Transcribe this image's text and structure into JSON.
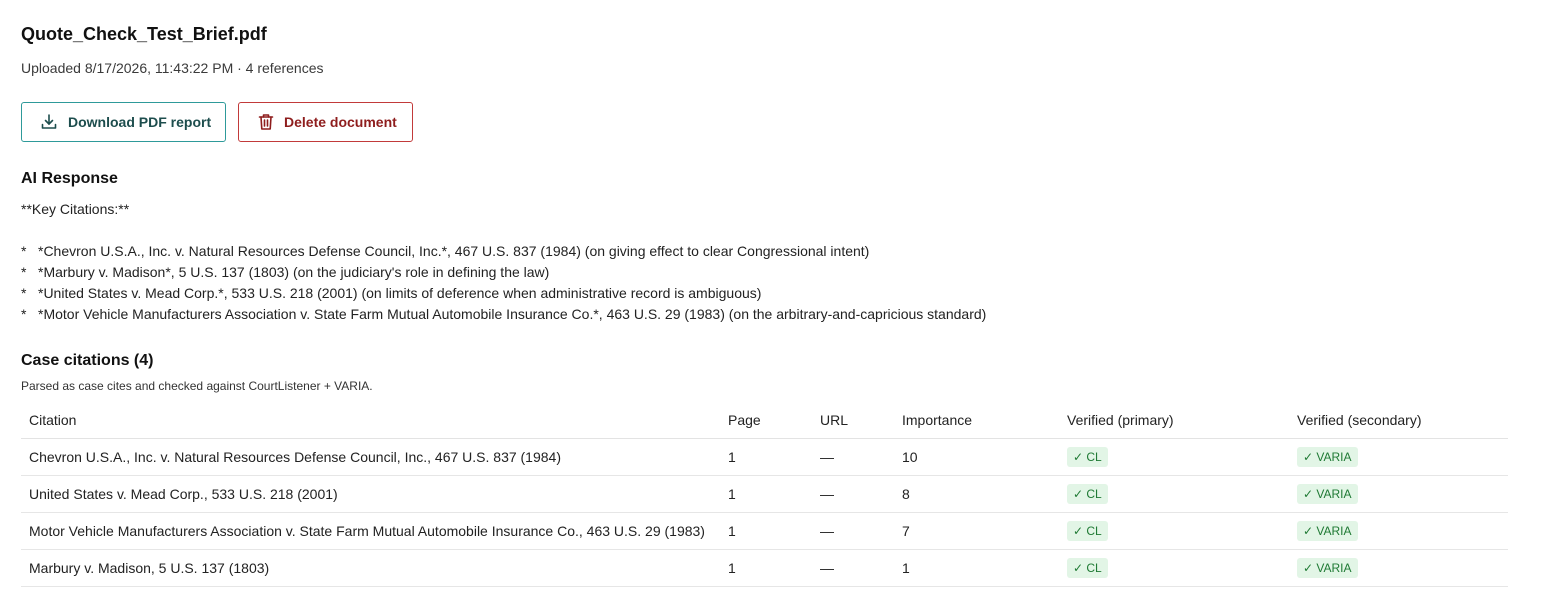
{
  "document": {
    "title": "Quote_Check_Test_Brief.pdf",
    "meta": "Uploaded 8/17/2026, 11:43:22 PM · 4 references"
  },
  "actions": {
    "download_label": "Download PDF report",
    "delete_label": "Delete document"
  },
  "ai_response": {
    "heading": "AI Response",
    "key_line": "**Key Citations:**",
    "bullet_char": "*",
    "items": [
      "*Chevron U.S.A., Inc. v. Natural Resources Defense Council, Inc.*, 467 U.S. 837 (1984) (on giving effect to clear Congressional intent)",
      "*Marbury v. Madison*, 5 U.S. 137 (1803) (on the judiciary's role in defining the law)",
      "*United States v. Mead Corp.*, 533 U.S. 218 (2001) (on limits of deference when administrative record is ambiguous)",
      "*Motor Vehicle Manufacturers Association v. State Farm Mutual Automobile Insurance Co.*, 463 U.S. 29 (1983) (on the arbitrary-and-capricious standard)"
    ]
  },
  "cases": {
    "heading": "Case citations (4)",
    "subtitle": "Parsed as case cites and checked against CourtListener + VARIA.",
    "columns": [
      "Citation",
      "Page",
      "URL",
      "Importance",
      "Verified (primary)",
      "Verified (secondary)"
    ],
    "rows": [
      {
        "citation": "Chevron U.S.A., Inc. v. Natural Resources Defense Council, Inc., 467 U.S. 837 (1984)",
        "page": "1",
        "url": "—",
        "importance": "10",
        "primary": "✓ CL",
        "secondary": "✓ VARIA"
      },
      {
        "citation": "United States v. Mead Corp., 533 U.S. 218 (2001)",
        "page": "1",
        "url": "—",
        "importance": "8",
        "primary": "✓ CL",
        "secondary": "✓ VARIA"
      },
      {
        "citation": "Motor Vehicle Manufacturers Association v. State Farm Mutual Automobile Insurance Co., 463 U.S. 29 (1983)",
        "page": "1",
        "url": "—",
        "importance": "7",
        "primary": "✓ CL",
        "secondary": "✓ VARIA"
      },
      {
        "citation": "Marbury v. Madison, 5 U.S. 137 (1803)",
        "page": "1",
        "url": "—",
        "importance": "1",
        "primary": "✓ CL",
        "secondary": "✓ VARIA"
      }
    ]
  },
  "colors": {
    "download_border": "#2e9a9a",
    "delete_border": "#c23a3a",
    "badge_bg": "#e2f5e6",
    "badge_text": "#1f7a34"
  },
  "icons": {
    "download": "download-icon",
    "delete": "trash-icon"
  }
}
